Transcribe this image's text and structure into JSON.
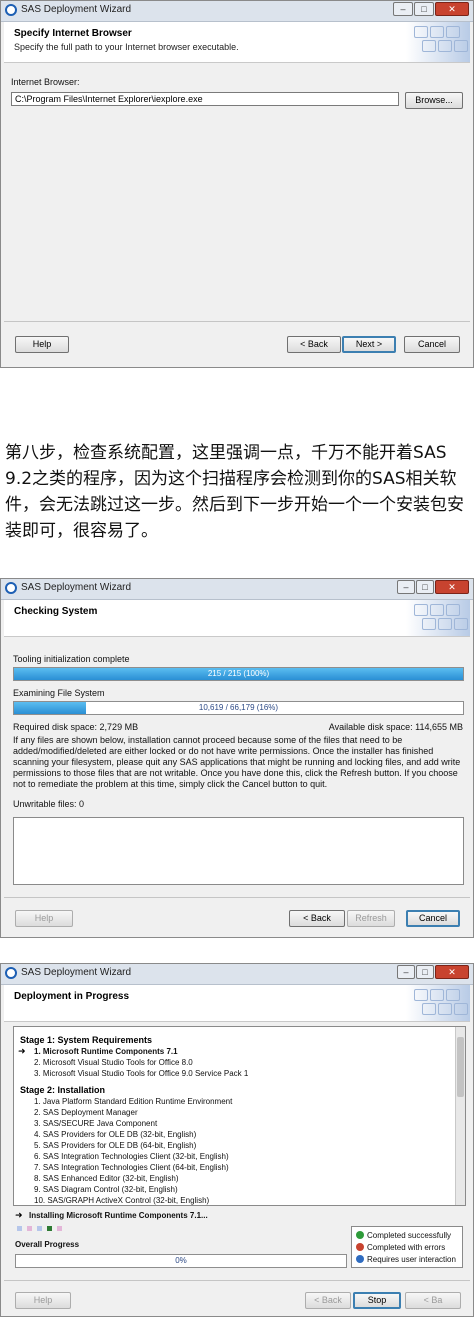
{
  "colors": {
    "accent": "#2a8fd4",
    "close": "#c8432f",
    "success": "#2e9b3a",
    "error": "#c8432f",
    "info": "#2f6cc0"
  },
  "window1": {
    "title": "SAS Deployment Wizard",
    "header_title": "Specify Internet Browser",
    "header_subtitle": "Specify the full path to your Internet browser executable.",
    "field_label": "Internet Browser:",
    "field_value": "C:\\Program Files\\Internet Explorer\\iexplore.exe",
    "browse": "Browse...",
    "help": "Help",
    "back": "< Back",
    "next": "Next >",
    "cancel": "Cancel"
  },
  "paragraph": "第八步，检查系统配置，这里强调一点，千万不能开着SAS 9.2之类的程序，因为这个扫描程序会检测到你的SAS相关软件，会无法跳过这一步。然后到下一步开始一个一个安装包安装即可，很容易了。",
  "window2": {
    "title": "SAS Deployment Wizard",
    "header_title": "Checking System",
    "tooling_label": "Tooling initialization complete",
    "tooling_text": "215 / 215 (100%)",
    "tooling_progress": 1.0,
    "examining_label": "Examining File System",
    "examining_text": "10,619 / 66,179 (16%)",
    "examining_progress": 0.16,
    "required": "Required disk space: 2,729 MB",
    "available": "Available disk space: 114,655 MB",
    "note": "If any files are shown below, installation cannot proceed because some of the files that need to be added/modified/deleted are either locked or do not have write permissions. Once the installer has finished scanning your filesystem, please quit any SAS applications that might be running and locking files, and add write permissions to those files that are not writable. Once you have done this, click the Refresh button. If you choose not to remediate the problem at this time, simply click the Cancel button to quit.",
    "unwritable": "Unwritable files: 0",
    "help": "Help",
    "back": "< Back",
    "refresh": "Refresh",
    "cancel": "Cancel"
  },
  "window3": {
    "title": "SAS Deployment Wizard",
    "header_title": "Deployment in Progress",
    "stage1": "Stage 1: System Requirements",
    "stage1_steps": [
      "1.  Microsoft Runtime Components 7.1",
      "2.  Microsoft Visual Studio Tools for Office 8.0",
      "3.  Microsoft Visual Studio Tools for Office 9.0 Service Pack 1"
    ],
    "stage2": "Stage 2: Installation",
    "stage2_steps": [
      "1.  Java Platform Standard Edition Runtime Environment",
      "2.  SAS Deployment Manager",
      "3.  SAS/SECURE Java Component",
      "4.  SAS Providers for OLE DB (32-bit, English)",
      "5.  SAS Providers for OLE DB (64-bit, English)",
      "6.  SAS Integration Technologies Client (32-bit, English)",
      "7.  SAS Integration Technologies Client (64-bit, English)",
      "8.  SAS Enhanced Editor (32-bit, English)",
      "9.  SAS Diagram Control (32-bit, English)",
      "10.  SAS/GRAPH ActiveX Control (32-bit, English)"
    ],
    "installing": "Installing Microsoft Runtime Components 7.1...",
    "overall_label": "Overall Progress",
    "overall_text": "0%",
    "overall_progress": 0.0,
    "legend_success": "Completed successfully",
    "legend_errors": "Completed with errors",
    "legend_user": "Requires user interaction",
    "help": "Help",
    "back": "< Back",
    "stop": "Stop",
    "cancel_label": "< Ba"
  }
}
